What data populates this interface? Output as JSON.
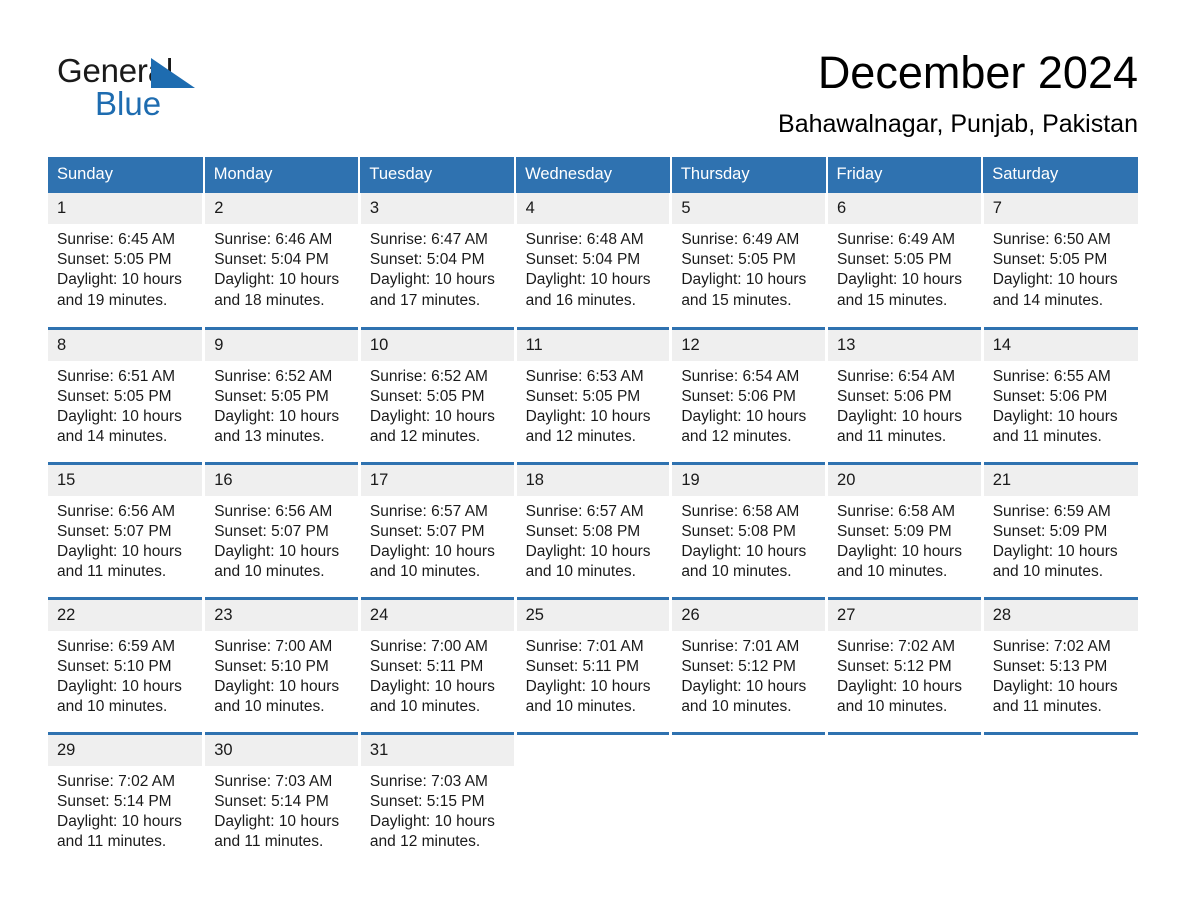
{
  "brand": {
    "line1": "General",
    "line2": "Blue",
    "triangle_color": "#1e6cb0",
    "text_color": "#1a1a1a"
  },
  "header": {
    "title": "December 2024",
    "location": "Bahawalnagar, Punjab, Pakistan"
  },
  "theme": {
    "header_blue": "#2f72b0",
    "daynum_gray": "#efefef",
    "row_divider_blue": "#2f72b0",
    "background": "#ffffff"
  },
  "calendar": {
    "weekday_headers": [
      "Sunday",
      "Monday",
      "Tuesday",
      "Wednesday",
      "Thursday",
      "Friday",
      "Saturday"
    ],
    "weeks": [
      [
        {
          "day": "1",
          "sunrise": "Sunrise: 6:45 AM",
          "sunset": "Sunset: 5:05 PM",
          "daylight_l1": "Daylight: 10 hours",
          "daylight_l2": "and 19 minutes."
        },
        {
          "day": "2",
          "sunrise": "Sunrise: 6:46 AM",
          "sunset": "Sunset: 5:04 PM",
          "daylight_l1": "Daylight: 10 hours",
          "daylight_l2": "and 18 minutes."
        },
        {
          "day": "3",
          "sunrise": "Sunrise: 6:47 AM",
          "sunset": "Sunset: 5:04 PM",
          "daylight_l1": "Daylight: 10 hours",
          "daylight_l2": "and 17 minutes."
        },
        {
          "day": "4",
          "sunrise": "Sunrise: 6:48 AM",
          "sunset": "Sunset: 5:04 PM",
          "daylight_l1": "Daylight: 10 hours",
          "daylight_l2": "and 16 minutes."
        },
        {
          "day": "5",
          "sunrise": "Sunrise: 6:49 AM",
          "sunset": "Sunset: 5:05 PM",
          "daylight_l1": "Daylight: 10 hours",
          "daylight_l2": "and 15 minutes."
        },
        {
          "day": "6",
          "sunrise": "Sunrise: 6:49 AM",
          "sunset": "Sunset: 5:05 PM",
          "daylight_l1": "Daylight: 10 hours",
          "daylight_l2": "and 15 minutes."
        },
        {
          "day": "7",
          "sunrise": "Sunrise: 6:50 AM",
          "sunset": "Sunset: 5:05 PM",
          "daylight_l1": "Daylight: 10 hours",
          "daylight_l2": "and 14 minutes."
        }
      ],
      [
        {
          "day": "8",
          "sunrise": "Sunrise: 6:51 AM",
          "sunset": "Sunset: 5:05 PM",
          "daylight_l1": "Daylight: 10 hours",
          "daylight_l2": "and 14 minutes."
        },
        {
          "day": "9",
          "sunrise": "Sunrise: 6:52 AM",
          "sunset": "Sunset: 5:05 PM",
          "daylight_l1": "Daylight: 10 hours",
          "daylight_l2": "and 13 minutes."
        },
        {
          "day": "10",
          "sunrise": "Sunrise: 6:52 AM",
          "sunset": "Sunset: 5:05 PM",
          "daylight_l1": "Daylight: 10 hours",
          "daylight_l2": "and 12 minutes."
        },
        {
          "day": "11",
          "sunrise": "Sunrise: 6:53 AM",
          "sunset": "Sunset: 5:05 PM",
          "daylight_l1": "Daylight: 10 hours",
          "daylight_l2": "and 12 minutes."
        },
        {
          "day": "12",
          "sunrise": "Sunrise: 6:54 AM",
          "sunset": "Sunset: 5:06 PM",
          "daylight_l1": "Daylight: 10 hours",
          "daylight_l2": "and 12 minutes."
        },
        {
          "day": "13",
          "sunrise": "Sunrise: 6:54 AM",
          "sunset": "Sunset: 5:06 PM",
          "daylight_l1": "Daylight: 10 hours",
          "daylight_l2": "and 11 minutes."
        },
        {
          "day": "14",
          "sunrise": "Sunrise: 6:55 AM",
          "sunset": "Sunset: 5:06 PM",
          "daylight_l1": "Daylight: 10 hours",
          "daylight_l2": "and 11 minutes."
        }
      ],
      [
        {
          "day": "15",
          "sunrise": "Sunrise: 6:56 AM",
          "sunset": "Sunset: 5:07 PM",
          "daylight_l1": "Daylight: 10 hours",
          "daylight_l2": "and 11 minutes."
        },
        {
          "day": "16",
          "sunrise": "Sunrise: 6:56 AM",
          "sunset": "Sunset: 5:07 PM",
          "daylight_l1": "Daylight: 10 hours",
          "daylight_l2": "and 10 minutes."
        },
        {
          "day": "17",
          "sunrise": "Sunrise: 6:57 AM",
          "sunset": "Sunset: 5:07 PM",
          "daylight_l1": "Daylight: 10 hours",
          "daylight_l2": "and 10 minutes."
        },
        {
          "day": "18",
          "sunrise": "Sunrise: 6:57 AM",
          "sunset": "Sunset: 5:08 PM",
          "daylight_l1": "Daylight: 10 hours",
          "daylight_l2": "and 10 minutes."
        },
        {
          "day": "19",
          "sunrise": "Sunrise: 6:58 AM",
          "sunset": "Sunset: 5:08 PM",
          "daylight_l1": "Daylight: 10 hours",
          "daylight_l2": "and 10 minutes."
        },
        {
          "day": "20",
          "sunrise": "Sunrise: 6:58 AM",
          "sunset": "Sunset: 5:09 PM",
          "daylight_l1": "Daylight: 10 hours",
          "daylight_l2": "and 10 minutes."
        },
        {
          "day": "21",
          "sunrise": "Sunrise: 6:59 AM",
          "sunset": "Sunset: 5:09 PM",
          "daylight_l1": "Daylight: 10 hours",
          "daylight_l2": "and 10 minutes."
        }
      ],
      [
        {
          "day": "22",
          "sunrise": "Sunrise: 6:59 AM",
          "sunset": "Sunset: 5:10 PM",
          "daylight_l1": "Daylight: 10 hours",
          "daylight_l2": "and 10 minutes."
        },
        {
          "day": "23",
          "sunrise": "Sunrise: 7:00 AM",
          "sunset": "Sunset: 5:10 PM",
          "daylight_l1": "Daylight: 10 hours",
          "daylight_l2": "and 10 minutes."
        },
        {
          "day": "24",
          "sunrise": "Sunrise: 7:00 AM",
          "sunset": "Sunset: 5:11 PM",
          "daylight_l1": "Daylight: 10 hours",
          "daylight_l2": "and 10 minutes."
        },
        {
          "day": "25",
          "sunrise": "Sunrise: 7:01 AM",
          "sunset": "Sunset: 5:11 PM",
          "daylight_l1": "Daylight: 10 hours",
          "daylight_l2": "and 10 minutes."
        },
        {
          "day": "26",
          "sunrise": "Sunrise: 7:01 AM",
          "sunset": "Sunset: 5:12 PM",
          "daylight_l1": "Daylight: 10 hours",
          "daylight_l2": "and 10 minutes."
        },
        {
          "day": "27",
          "sunrise": "Sunrise: 7:02 AM",
          "sunset": "Sunset: 5:12 PM",
          "daylight_l1": "Daylight: 10 hours",
          "daylight_l2": "and 10 minutes."
        },
        {
          "day": "28",
          "sunrise": "Sunrise: 7:02 AM",
          "sunset": "Sunset: 5:13 PM",
          "daylight_l1": "Daylight: 10 hours",
          "daylight_l2": "and 11 minutes."
        }
      ],
      [
        {
          "day": "29",
          "sunrise": "Sunrise: 7:02 AM",
          "sunset": "Sunset: 5:14 PM",
          "daylight_l1": "Daylight: 10 hours",
          "daylight_l2": "and 11 minutes."
        },
        {
          "day": "30",
          "sunrise": "Sunrise: 7:03 AM",
          "sunset": "Sunset: 5:14 PM",
          "daylight_l1": "Daylight: 10 hours",
          "daylight_l2": "and 11 minutes."
        },
        {
          "day": "31",
          "sunrise": "Sunrise: 7:03 AM",
          "sunset": "Sunset: 5:15 PM",
          "daylight_l1": "Daylight: 10 hours",
          "daylight_l2": "and 12 minutes."
        },
        {
          "day": "",
          "sunrise": "",
          "sunset": "",
          "daylight_l1": "",
          "daylight_l2": "",
          "empty": true
        },
        {
          "day": "",
          "sunrise": "",
          "sunset": "",
          "daylight_l1": "",
          "daylight_l2": "",
          "empty": true
        },
        {
          "day": "",
          "sunrise": "",
          "sunset": "",
          "daylight_l1": "",
          "daylight_l2": "",
          "empty": true
        },
        {
          "day": "",
          "sunrise": "",
          "sunset": "",
          "daylight_l1": "",
          "daylight_l2": "",
          "empty": true
        }
      ]
    ]
  }
}
